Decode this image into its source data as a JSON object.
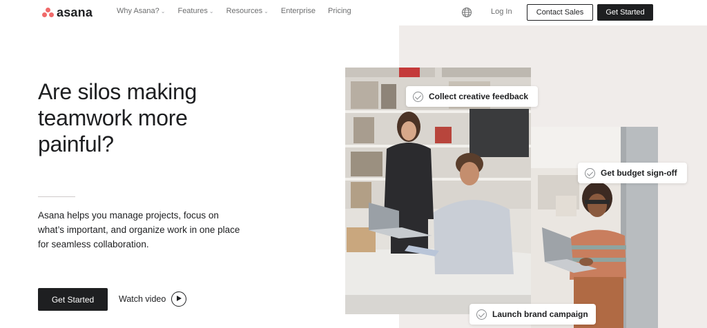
{
  "nav": {
    "logo_text": "asana",
    "links": [
      {
        "label": "Why Asana?",
        "has_dropdown": true
      },
      {
        "label": "Features",
        "has_dropdown": true
      },
      {
        "label": "Resources",
        "has_dropdown": true
      },
      {
        "label": "Enterprise",
        "has_dropdown": false
      },
      {
        "label": "Pricing",
        "has_dropdown": false
      }
    ],
    "language_icon": "globe-icon",
    "login_label": "Log In",
    "contact_sales_label": "Contact Sales",
    "get_started_label": "Get Started"
  },
  "hero": {
    "title": "Are silos making teamwork more painful?",
    "body": "Asana helps you manage projects, focus on what’s important, and organize work in one place for seamless collaboration.",
    "primary_cta": "Get Started",
    "secondary_cta": "Watch video"
  },
  "tasks": [
    {
      "label": "Collect creative feedback"
    },
    {
      "label": "Get budget sign-off"
    },
    {
      "label": "Launch brand campaign"
    }
  ],
  "colors": {
    "brand": "#f06a6a",
    "text": "#1e1f21",
    "panel_bg": "#f0ecea"
  }
}
